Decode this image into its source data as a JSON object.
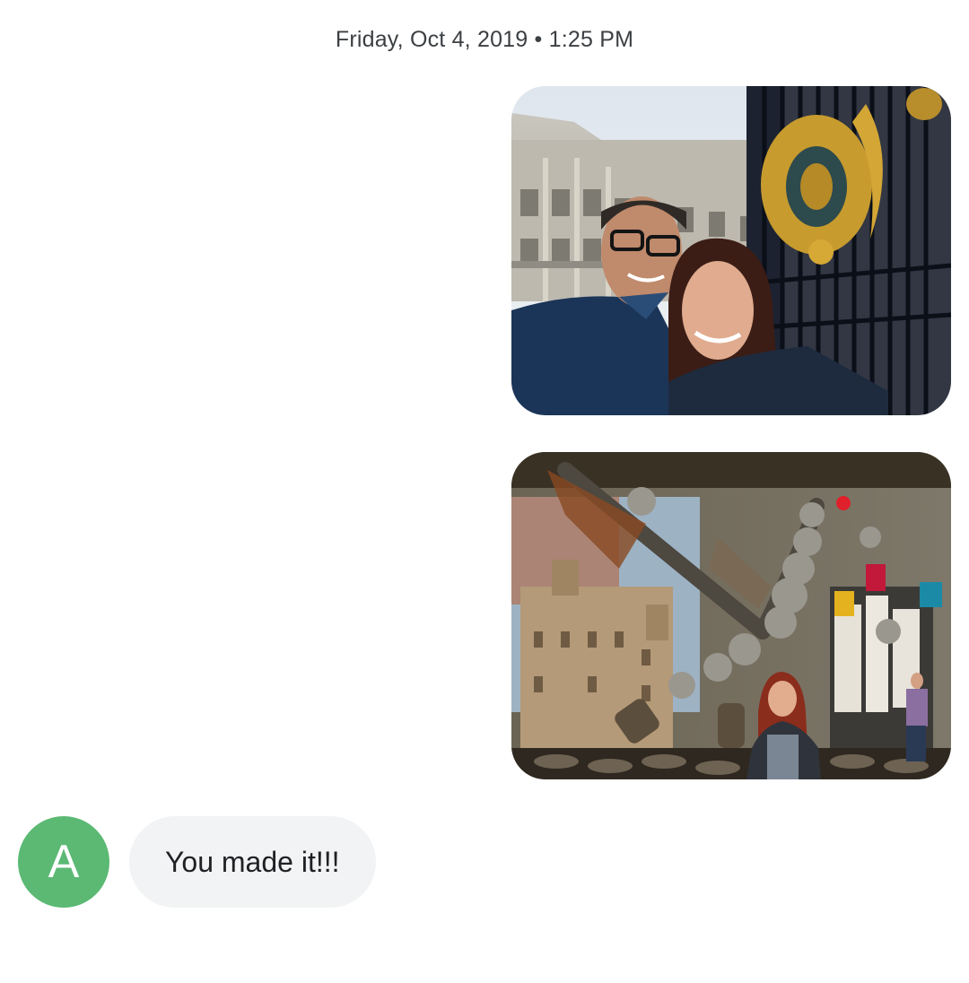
{
  "thread": {
    "timestamp": "Friday, Oct 4, 2019 • 1:25 PM",
    "outgoing_images": [
      {
        "description_icon": "photo-selfie-gate"
      },
      {
        "description_icon": "photo-dragon-sculpture"
      }
    ],
    "incoming_message": {
      "avatar_letter": "A",
      "avatar_color": "#5bb974",
      "text": "You made it!!!"
    }
  },
  "colors": {
    "bubble_incoming": "#f1f3f4",
    "text_primary": "#202124",
    "text_secondary": "#3c4043"
  }
}
